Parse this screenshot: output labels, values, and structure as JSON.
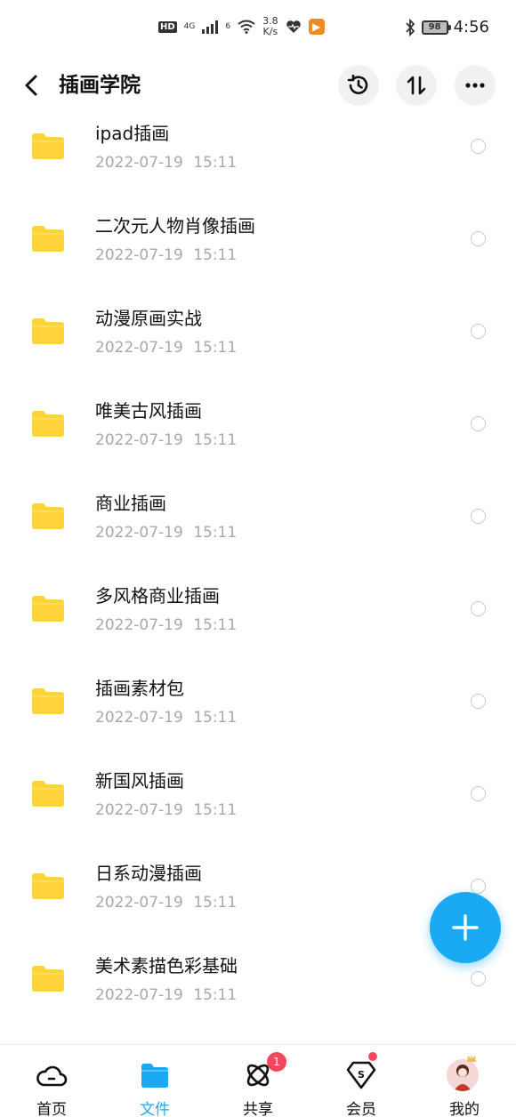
{
  "status_bar": {
    "hd": "HD",
    "signal1": "4G",
    "signal2": "6",
    "speed_value": "3.8",
    "speed_unit": "K/s",
    "battery": "98",
    "time": "4:56"
  },
  "header": {
    "title": "插画学院"
  },
  "files": [
    {
      "name": "ipad插画",
      "date": "2022-07-19 15:11"
    },
    {
      "name": "二次元人物肖像插画",
      "date": "2022-07-19 15:11"
    },
    {
      "name": "动漫原画实战",
      "date": "2022-07-19 15:11"
    },
    {
      "name": "唯美古风插画",
      "date": "2022-07-19 15:11"
    },
    {
      "name": "商业插画",
      "date": "2022-07-19 15:11"
    },
    {
      "name": "多风格商业插画",
      "date": "2022-07-19 15:11"
    },
    {
      "name": "插画素材包",
      "date": "2022-07-19 15:11"
    },
    {
      "name": "新国风插画",
      "date": "2022-07-19 15:11"
    },
    {
      "name": "日系动漫插画",
      "date": "2022-07-19 15:11"
    },
    {
      "name": "美术素描色彩基础",
      "date": "2022-07-19 15:11"
    }
  ],
  "tabs": [
    {
      "label": "首页",
      "icon": "cloud-icon"
    },
    {
      "label": "文件",
      "icon": "folder-icon"
    },
    {
      "label": "共享",
      "icon": "atom-icon",
      "badge": "1"
    },
    {
      "label": "会员",
      "icon": "vip-diamond-icon"
    },
    {
      "label": "我的",
      "icon": "avatar"
    }
  ],
  "colors": {
    "accent": "#1aa9f3",
    "folder": "#ffd43b",
    "badge": "#f5475b",
    "date_text": "#a7a8ad"
  }
}
